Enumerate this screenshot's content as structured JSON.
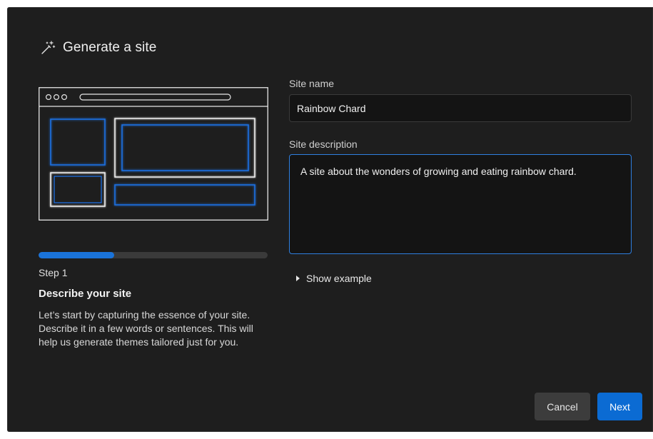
{
  "dialog": {
    "title": "Generate a site",
    "title_icon": "magic-wand-icon"
  },
  "progress": {
    "value": 0.33,
    "color": "#1a73d9"
  },
  "step": {
    "label": "Step 1",
    "title": "Describe your site",
    "description": "Let’s start by capturing the essence of your site. Describe it in a few words or sentences. This will help us generate themes tailored just for you."
  },
  "form": {
    "site_name": {
      "label": "Site name",
      "value": "Rainbow Chard"
    },
    "site_description": {
      "label": "Site description",
      "value": "A site about the wonders of growing and eating rainbow chard."
    },
    "show_example": "Show example"
  },
  "buttons": {
    "cancel": "Cancel",
    "next": "Next"
  },
  "colors": {
    "accent": "#0b6bd3",
    "background": "#1e1e1e"
  }
}
